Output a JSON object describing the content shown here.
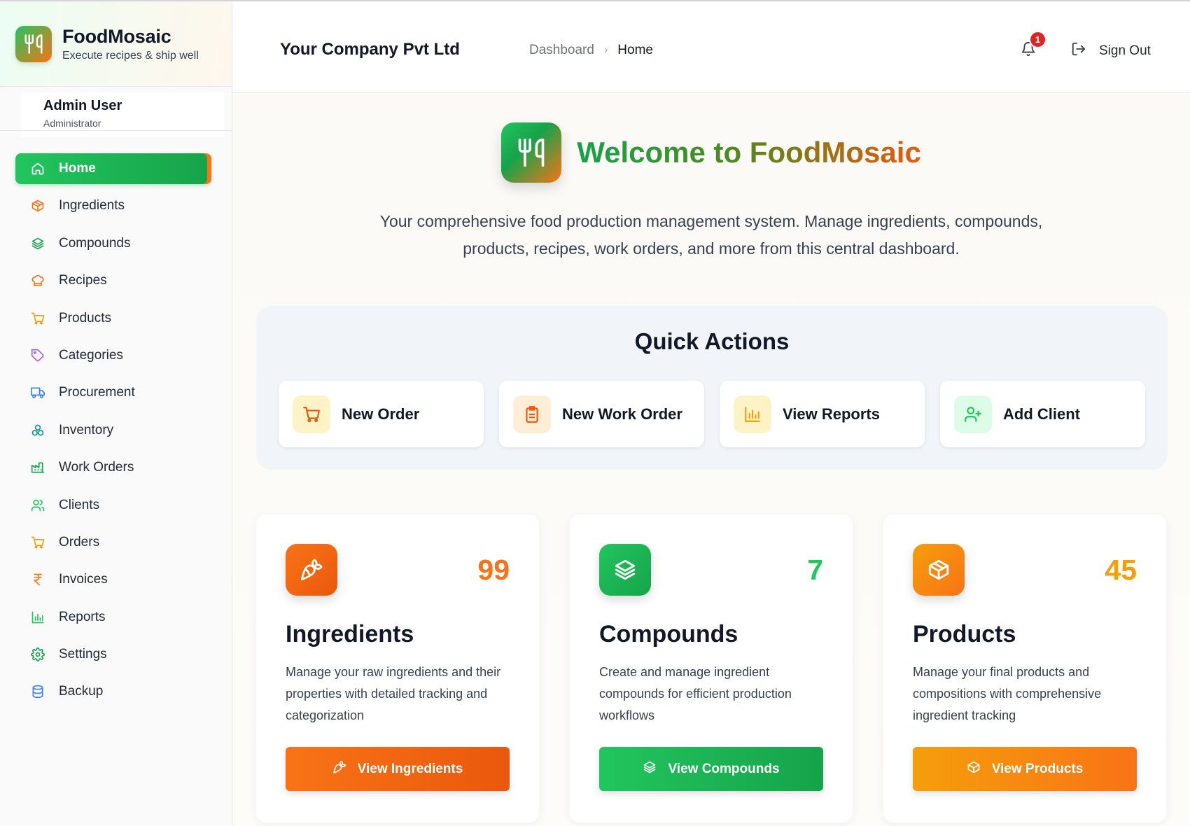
{
  "brand": {
    "name": "FoodMosaic",
    "tagline": "Execute recipes & ship well"
  },
  "user": {
    "name": "Admin User",
    "role": "Administrator"
  },
  "nav": [
    {
      "label": "Home",
      "icon": "home-icon",
      "active": true
    },
    {
      "label": "Ingredients",
      "icon": "cube-icon"
    },
    {
      "label": "Compounds",
      "icon": "layers-icon"
    },
    {
      "label": "Recipes",
      "icon": "chef-hat-icon"
    },
    {
      "label": "Products",
      "icon": "cart-icon"
    },
    {
      "label": "Categories",
      "icon": "tag-icon"
    },
    {
      "label": "Procurement",
      "icon": "truck-icon"
    },
    {
      "label": "Inventory",
      "icon": "boxes-icon"
    },
    {
      "label": "Work Orders",
      "icon": "factory-icon"
    },
    {
      "label": "Clients",
      "icon": "users-icon"
    },
    {
      "label": "Orders",
      "icon": "cart-icon"
    },
    {
      "label": "Invoices",
      "icon": "rupee-icon"
    },
    {
      "label": "Reports",
      "icon": "bar-chart-icon"
    },
    {
      "label": "Settings",
      "icon": "gear-icon"
    },
    {
      "label": "Backup",
      "icon": "database-icon"
    }
  ],
  "header": {
    "company": "Your Company Pvt Ltd",
    "breadcrumb": [
      "Dashboard",
      "Home"
    ],
    "notification_count": "1",
    "signout": "Sign Out"
  },
  "hero": {
    "title": "Welcome to FoodMosaic",
    "subtitle": "Your comprehensive food production management system. Manage ingredients, compounds, products, recipes, work orders, and more from this central dashboard."
  },
  "quick_actions": {
    "title": "Quick Actions",
    "items": [
      {
        "label": "New Order",
        "icon": "cart-icon"
      },
      {
        "label": "New Work Order",
        "icon": "clipboard-icon"
      },
      {
        "label": "View Reports",
        "icon": "bar-chart-icon"
      },
      {
        "label": "Add Client",
        "icon": "user-plus-icon"
      }
    ]
  },
  "cards": [
    {
      "title": "Ingredients",
      "count": "99",
      "description": "Manage your raw ingredients and their properties with detailed tracking and categorization",
      "button": "View Ingredients",
      "icon": "carrot-icon",
      "accent": "#f97316"
    },
    {
      "title": "Compounds",
      "count": "7",
      "description": "Create and manage ingredient compounds for efficient production workflows",
      "button": "View Compounds",
      "icon": "layers-icon",
      "accent": "#22c55e"
    },
    {
      "title": "Products",
      "count": "45",
      "description": "Manage your final products and compositions with comprehensive ingredient tracking",
      "button": "View Products",
      "icon": "package-icon",
      "accent": "#f59e0b"
    }
  ],
  "colors": {
    "green": "#22c55e",
    "orange": "#f97316",
    "amber": "#f59e0b"
  }
}
